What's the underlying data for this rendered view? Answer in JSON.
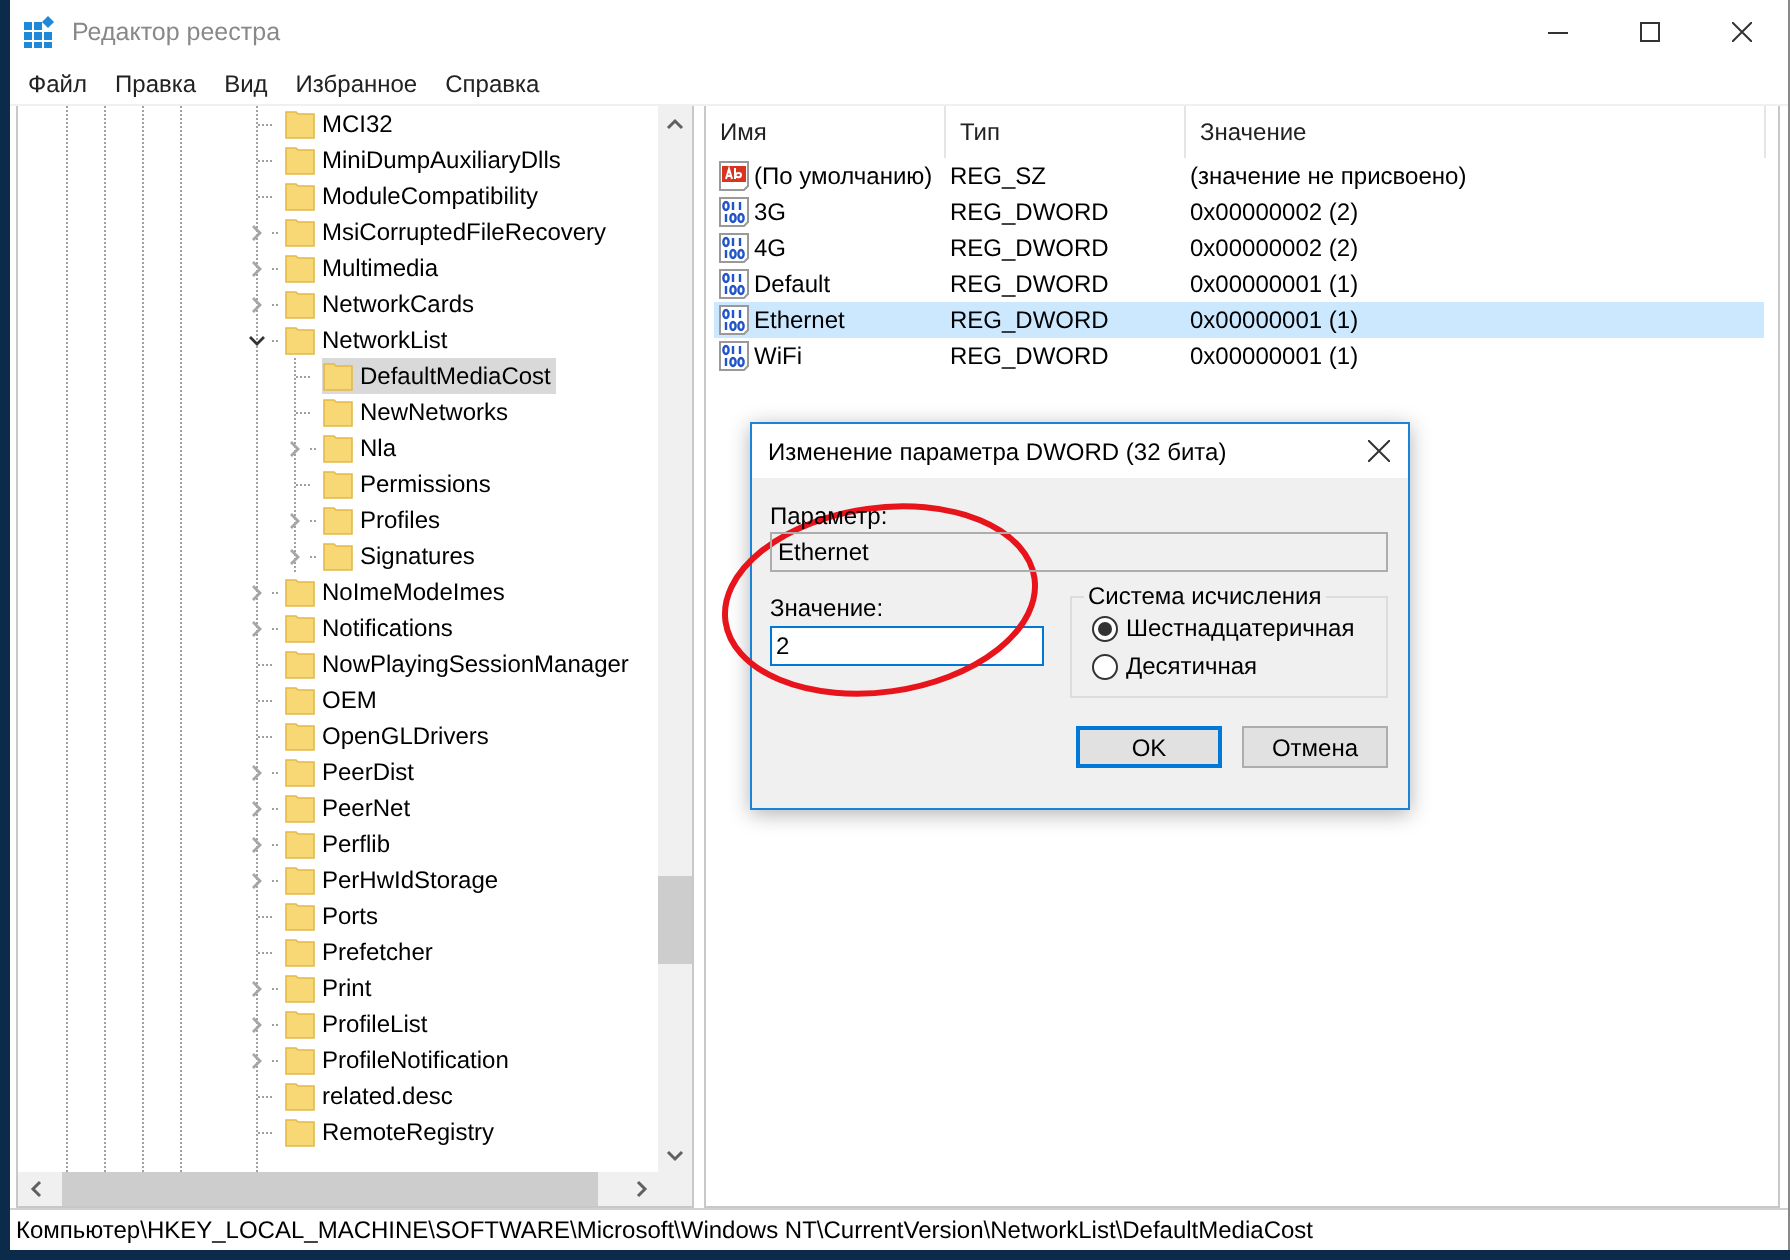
{
  "window": {
    "title": "Редактор реестра"
  },
  "menu": [
    "Файл",
    "Правка",
    "Вид",
    "Избранное",
    "Справка"
  ],
  "tree": {
    "items": [
      {
        "label": "MCI32",
        "kind": "leaf",
        "selected": false
      },
      {
        "label": "MiniDumpAuxiliaryDlls",
        "kind": "leaf",
        "selected": false
      },
      {
        "label": "ModuleCompatibility",
        "kind": "leaf",
        "selected": false
      },
      {
        "label": "MsiCorruptedFileRecovery",
        "kind": "collapsed",
        "selected": false
      },
      {
        "label": "Multimedia",
        "kind": "collapsed",
        "selected": false
      },
      {
        "label": "NetworkCards",
        "kind": "collapsed",
        "selected": false
      },
      {
        "label": "NetworkList",
        "kind": "expanded",
        "selected": false,
        "children": [
          {
            "label": "DefaultMediaCost",
            "kind": "leaf",
            "selected": true
          },
          {
            "label": "NewNetworks",
            "kind": "leaf",
            "selected": false
          },
          {
            "label": "Nla",
            "kind": "collapsed",
            "selected": false
          },
          {
            "label": "Permissions",
            "kind": "leaf",
            "selected": false
          },
          {
            "label": "Profiles",
            "kind": "collapsed",
            "selected": false
          },
          {
            "label": "Signatures",
            "kind": "collapsed",
            "selected": false
          }
        ]
      },
      {
        "label": "NoImeModeImes",
        "kind": "collapsed",
        "selected": false
      },
      {
        "label": "Notifications",
        "kind": "collapsed",
        "selected": false
      },
      {
        "label": "NowPlayingSessionManager",
        "kind": "leaf",
        "selected": false
      },
      {
        "label": "OEM",
        "kind": "leaf",
        "selected": false
      },
      {
        "label": "OpenGLDrivers",
        "kind": "leaf",
        "selected": false
      },
      {
        "label": "PeerDist",
        "kind": "collapsed",
        "selected": false
      },
      {
        "label": "PeerNet",
        "kind": "collapsed",
        "selected": false
      },
      {
        "label": "Perflib",
        "kind": "collapsed",
        "selected": false
      },
      {
        "label": "PerHwIdStorage",
        "kind": "collapsed",
        "selected": false
      },
      {
        "label": "Ports",
        "kind": "leaf",
        "selected": false
      },
      {
        "label": "Prefetcher",
        "kind": "leaf",
        "selected": false
      },
      {
        "label": "Print",
        "kind": "collapsed",
        "selected": false
      },
      {
        "label": "ProfileList",
        "kind": "collapsed",
        "selected": false
      },
      {
        "label": "ProfileNotification",
        "kind": "collapsed",
        "selected": false
      },
      {
        "label": "related.desc",
        "kind": "leaf",
        "selected": false
      },
      {
        "label": "RemoteRegistry",
        "kind": "leaf",
        "selected": false
      }
    ]
  },
  "values": {
    "columns": [
      "Имя",
      "Тип",
      "Значение"
    ],
    "rows": [
      {
        "name": "(По умолчанию)",
        "type": "REG_SZ",
        "data": "(значение не присвоено)",
        "kind": "string",
        "selected": false
      },
      {
        "name": "3G",
        "type": "REG_DWORD",
        "data": "0x00000002 (2)",
        "kind": "binary",
        "selected": false
      },
      {
        "name": "4G",
        "type": "REG_DWORD",
        "data": "0x00000002 (2)",
        "kind": "binary",
        "selected": false
      },
      {
        "name": "Default",
        "type": "REG_DWORD",
        "data": "0x00000001 (1)",
        "kind": "binary",
        "selected": false
      },
      {
        "name": "Ethernet",
        "type": "REG_DWORD",
        "data": "0x00000001 (1)",
        "kind": "binary",
        "selected": true
      },
      {
        "name": "WiFi",
        "type": "REG_DWORD",
        "data": "0x00000001 (1)",
        "kind": "binary",
        "selected": false
      }
    ]
  },
  "dialog": {
    "title": "Изменение параметра DWORD (32 бита)",
    "name_label": "Параметр:",
    "name_value": "Ethernet",
    "value_label": "Значение:",
    "value": "2",
    "base_group": {
      "label": "Система исчисления",
      "options": [
        {
          "label": "Шестнадцатеричная",
          "selected": true
        },
        {
          "label": "Десятичная",
          "selected": false
        }
      ]
    },
    "buttons": [
      {
        "label": "OK",
        "default": true
      },
      {
        "label": "Отмена",
        "default": false
      }
    ]
  },
  "status_bar": "Компьютер\\HKEY_LOCAL_MACHINE\\SOFTWARE\\Microsoft\\Windows NT\\CurrentVersion\\NetworkList\\DefaultMediaCost"
}
